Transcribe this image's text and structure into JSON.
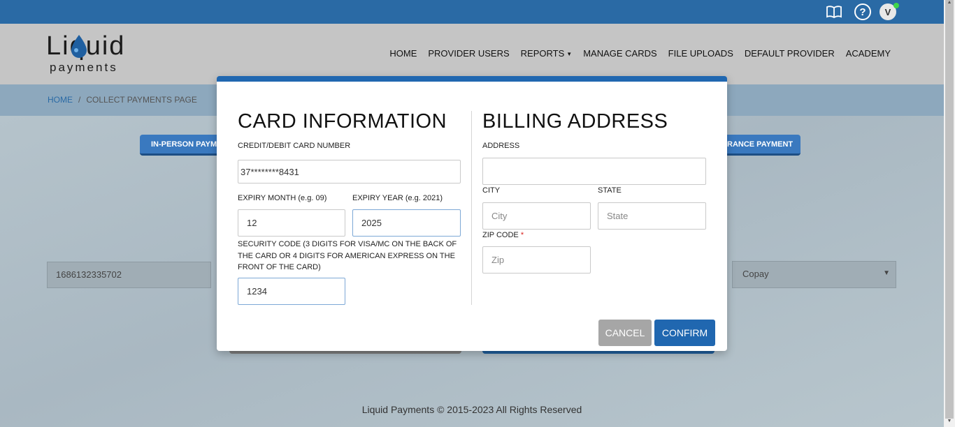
{
  "topbar": {
    "avatar_letter": "V"
  },
  "logo": {
    "top": "Liquid",
    "bottom": "payments"
  },
  "nav": {
    "items": [
      "HOME",
      "PROVIDER USERS",
      "REPORTS",
      "MANAGE CARDS",
      "FILE UPLOADS",
      "DEFAULT PROVIDER",
      "ACADEMY"
    ]
  },
  "breadcrumb": {
    "home": "HOME",
    "separator": "/",
    "current": "COLLECT PAYMENTS PAGE"
  },
  "background": {
    "pill_left": "IN-PERSON PAYME",
    "pill_right": "RANCE PAYMENT",
    "account_value": "1686132335702",
    "payment_type_selected": "Copay"
  },
  "footer": {
    "text": "Liquid Payments © 2015-2023 All Rights Reserved"
  },
  "modal": {
    "card_title": "CARD INFORMATION",
    "billing_title": "BILLING ADDRESS",
    "card_number_label": "CREDIT/DEBIT CARD NUMBER",
    "card_number_value": "37********8431",
    "expiry_month_label": "EXPIRY MONTH (e.g. 09)",
    "expiry_month_value": "12",
    "expiry_year_label": "EXPIRY YEAR (e.g. 2021)",
    "expiry_year_value": "2025",
    "security_label": "SECURITY CODE (3 DIGITS FOR VISA/MC ON THE BACK OF THE CARD OR 4 DIGITS FOR AMERICAN EXPRESS ON THE FRONT OF THE CARD)",
    "security_value": "1234",
    "address_label": "ADDRESS",
    "address_value": "",
    "city_label": "CITY",
    "city_placeholder": "City",
    "state_label": "STATE",
    "state_placeholder": "State",
    "zip_label": "ZIP CODE",
    "zip_required": "*",
    "zip_placeholder": "Zip",
    "cancel_label": "CANCEL",
    "confirm_label": "CONFIRM"
  },
  "colors": {
    "primary": "#2067b0",
    "topbar": "#2a6aa5",
    "cancel": "#a6a6a6"
  }
}
